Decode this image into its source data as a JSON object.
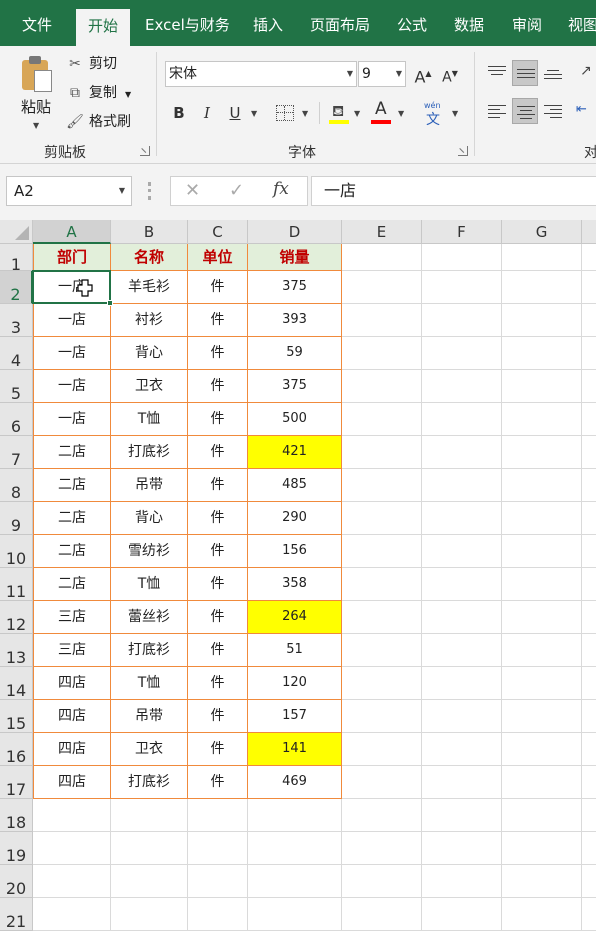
{
  "ribbon": {
    "tabs": [
      "文件",
      "开始",
      "Excel与财务",
      "插入",
      "页面布局",
      "公式",
      "数据",
      "审阅",
      "视图"
    ],
    "active_tab": "开始",
    "clipboard": {
      "paste": "粘贴",
      "cut": "剪切",
      "copy": "复制",
      "format_painter": "格式刷",
      "group_label": "剪贴板"
    },
    "font": {
      "font_name": "宋体",
      "font_size": "9",
      "group_label": "字体",
      "bold": "B",
      "italic": "I",
      "underline": "U",
      "grow": "A",
      "shrink": "A",
      "font_color_glyph": "A",
      "phonetic": "文",
      "phonetic_top": "wén"
    },
    "alignment": {
      "group_label_partial": "对"
    }
  },
  "formula_bar": {
    "name_box": "A2",
    "cancel": "✕",
    "enter": "✓",
    "fx": "fx",
    "content": "一店"
  },
  "sheet": {
    "columns": [
      "A",
      "B",
      "C",
      "D",
      "E",
      "F",
      "G"
    ],
    "rows": [
      "1",
      "2",
      "3",
      "4",
      "5",
      "6",
      "7",
      "8",
      "9",
      "10",
      "11",
      "12",
      "13",
      "14",
      "15",
      "16",
      "17",
      "18",
      "19",
      "20",
      "21"
    ],
    "header": [
      "部门",
      "名称",
      "单位",
      "销量"
    ],
    "data": [
      [
        "一店",
        "羊毛衫",
        "件",
        "375"
      ],
      [
        "一店",
        "衬衫",
        "件",
        "393"
      ],
      [
        "一店",
        "背心",
        "件",
        "59"
      ],
      [
        "一店",
        "卫衣",
        "件",
        "375"
      ],
      [
        "一店",
        "T恤",
        "件",
        "500"
      ],
      [
        "二店",
        "打底衫",
        "件",
        "421"
      ],
      [
        "二店",
        "吊带",
        "件",
        "485"
      ],
      [
        "二店",
        "背心",
        "件",
        "290"
      ],
      [
        "二店",
        "雪纺衫",
        "件",
        "156"
      ],
      [
        "二店",
        "T恤",
        "件",
        "358"
      ],
      [
        "三店",
        "蕾丝衫",
        "件",
        "264"
      ],
      [
        "三店",
        "打底衫",
        "件",
        "51"
      ],
      [
        "四店",
        "T恤",
        "件",
        "120"
      ],
      [
        "四店",
        "吊带",
        "件",
        "157"
      ],
      [
        "四店",
        "卫衣",
        "件",
        "141"
      ],
      [
        "四店",
        "打底衫",
        "件",
        "469"
      ]
    ],
    "highlighted_rows": [
      5,
      10,
      14
    ],
    "active_cell": "A2"
  },
  "colors": {
    "ribbon_green": "#217346",
    "header_fill": "#e2efda",
    "header_text": "#c00000",
    "highlight_fill": "#ffff00",
    "table_border": "#f08a3c",
    "font_color_bar": "#ff0000",
    "fill_color_bar": "#ffff00"
  }
}
